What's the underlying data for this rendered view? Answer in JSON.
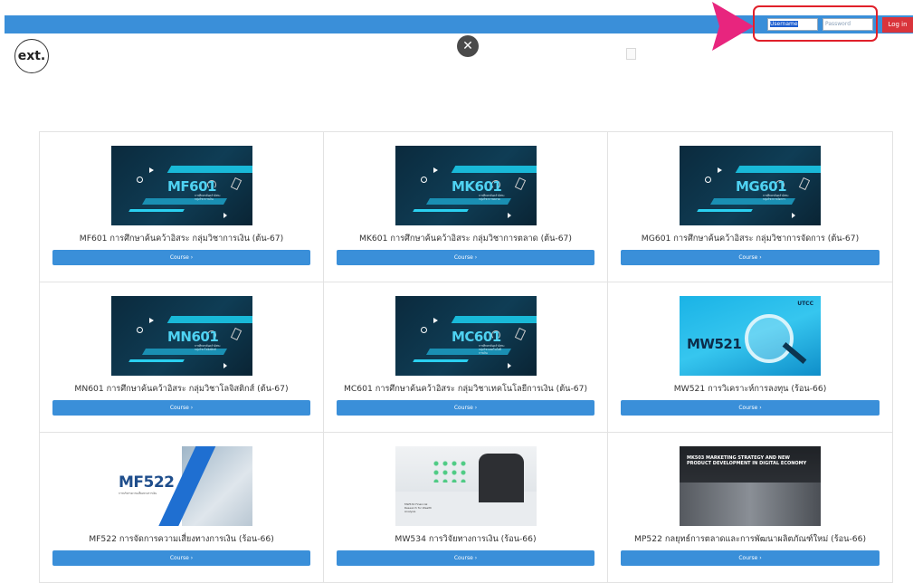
{
  "header": {
    "username_placeholder": "Username",
    "password_placeholder": "Password",
    "login_label": "Log in",
    "logo_text": "ext.",
    "close_symbol": "✕"
  },
  "colors": {
    "accent": "#3a8fd9",
    "login": "#d9343b",
    "highlight": "#e0202a",
    "pointer": "#e8257e"
  },
  "courses": [
    {
      "code": "MF601",
      "subtitle": "การศึกษาค้นคว้าอิสระ กลุ่มวิชาการเงิน",
      "title": "MF601 การศึกษาค้นคว้าอิสระ กลุ่มวิชาการเงิน (ต้น-67)",
      "button": "Course ›"
    },
    {
      "code": "MK601",
      "subtitle": "การศึกษาค้นคว้าอิสระ กลุ่มวิชาการตลาด",
      "title": "MK601 การศึกษาค้นคว้าอิสระ กลุ่มวิชาการตลาด (ต้น-67)",
      "button": "Course ›"
    },
    {
      "code": "MG601",
      "subtitle": "การศึกษาค้นคว้าอิสระ กลุ่มวิชาการจัดการ",
      "title": "MG601 การศึกษาค้นคว้าอิสระ กลุ่มวิชาการจัดการ (ต้น-67)",
      "button": "Course ›"
    },
    {
      "code": "MN601",
      "subtitle": "การศึกษาค้นคว้าอิสระ กลุ่มวิชาโลจิสติกส์",
      "title": "MN601 การศึกษาค้นคว้าอิสระ กลุ่มวิชาโลจิสติกส์ (ต้น-67)",
      "button": "Course ›"
    },
    {
      "code": "MC601",
      "subtitle": "การศึกษาค้นคว้าอิสระ กลุ่มวิชาเทคโนโลยีการเงิน",
      "title": "MC601 การศึกษาค้นคว้าอิสระ กลุ่มวิชาเทคโนโลยีการเงิน (ต้น-67)",
      "button": "Course ›"
    },
    {
      "code": "MW521",
      "subtitle": "UTCC",
      "title": "MW521 การวิเคราะห์การลงทุน (ร้อน-66)",
      "button": "Course ›"
    },
    {
      "code": "MF522",
      "subtitle": "การบริหารความเสี่ยงทางการเงิน",
      "title": "MF522 การจัดการความเสี่ยงทางการเงิน (ร้อน-66)",
      "button": "Course ›"
    },
    {
      "code": "MW534",
      "subtitle": "MW534 Financial Research for Wealth Analysis",
      "title": "MW534 การวิจัยทางการเงิน (ร้อน-66)",
      "button": "Course ›"
    },
    {
      "code": "MP522",
      "subtitle": "MK503 MARKETING STRATEGY AND NEW PRODUCT DEVELOPMENT IN DIGITAL ECONOMY",
      "title": "MP522 กลยุทธ์การตลาดและการพัฒนาผลิตภัณฑ์ใหม่ (ร้อน-66)",
      "button": "Course ›"
    }
  ]
}
